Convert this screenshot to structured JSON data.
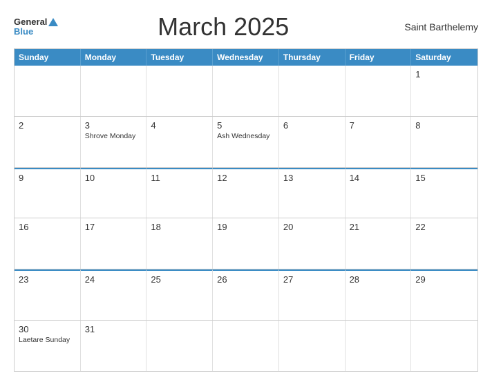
{
  "header": {
    "logo_general": "General",
    "logo_blue": "Blue",
    "title": "March 2025",
    "region": "Saint Barthelemy"
  },
  "calendar": {
    "days_of_week": [
      "Sunday",
      "Monday",
      "Tuesday",
      "Wednesday",
      "Thursday",
      "Friday",
      "Saturday"
    ],
    "weeks": [
      [
        {
          "day": "",
          "event": ""
        },
        {
          "day": "",
          "event": ""
        },
        {
          "day": "",
          "event": ""
        },
        {
          "day": "",
          "event": ""
        },
        {
          "day": "",
          "event": ""
        },
        {
          "day": "",
          "event": ""
        },
        {
          "day": "1",
          "event": ""
        }
      ],
      [
        {
          "day": "2",
          "event": ""
        },
        {
          "day": "3",
          "event": "Shrove Monday"
        },
        {
          "day": "4",
          "event": ""
        },
        {
          "day": "5",
          "event": "Ash Wednesday"
        },
        {
          "day": "6",
          "event": ""
        },
        {
          "day": "7",
          "event": ""
        },
        {
          "day": "8",
          "event": ""
        }
      ],
      [
        {
          "day": "9",
          "event": ""
        },
        {
          "day": "10",
          "event": ""
        },
        {
          "day": "11",
          "event": ""
        },
        {
          "day": "12",
          "event": ""
        },
        {
          "day": "13",
          "event": ""
        },
        {
          "day": "14",
          "event": ""
        },
        {
          "day": "15",
          "event": ""
        }
      ],
      [
        {
          "day": "16",
          "event": ""
        },
        {
          "day": "17",
          "event": ""
        },
        {
          "day": "18",
          "event": ""
        },
        {
          "day": "19",
          "event": ""
        },
        {
          "day": "20",
          "event": ""
        },
        {
          "day": "21",
          "event": ""
        },
        {
          "day": "22",
          "event": ""
        }
      ],
      [
        {
          "day": "23",
          "event": ""
        },
        {
          "day": "24",
          "event": ""
        },
        {
          "day": "25",
          "event": ""
        },
        {
          "day": "26",
          "event": ""
        },
        {
          "day": "27",
          "event": ""
        },
        {
          "day": "28",
          "event": ""
        },
        {
          "day": "29",
          "event": ""
        }
      ],
      [
        {
          "day": "30",
          "event": "Laetare Sunday"
        },
        {
          "day": "31",
          "event": ""
        },
        {
          "day": "",
          "event": ""
        },
        {
          "day": "",
          "event": ""
        },
        {
          "day": "",
          "event": ""
        },
        {
          "day": "",
          "event": ""
        },
        {
          "day": "",
          "event": ""
        }
      ]
    ],
    "blue_top_rows": [
      2,
      4
    ]
  }
}
